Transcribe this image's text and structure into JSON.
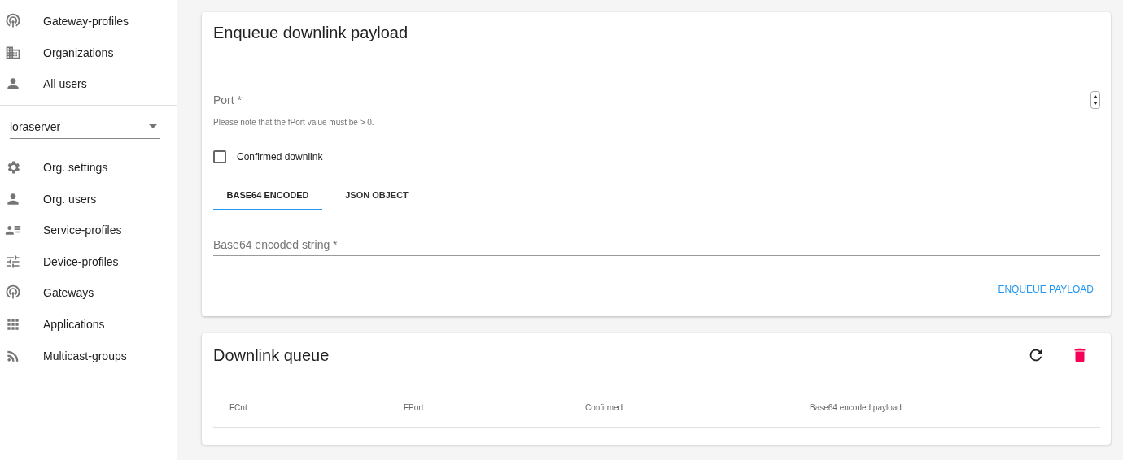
{
  "sidebar": {
    "top_items": [
      {
        "label": "Gateway-profiles"
      },
      {
        "label": "Organizations"
      },
      {
        "label": "All users"
      }
    ],
    "organization_select": {
      "value": "loraserver"
    },
    "org_items": [
      {
        "label": "Org. settings"
      },
      {
        "label": "Org. users"
      },
      {
        "label": "Service-profiles"
      },
      {
        "label": "Device-profiles"
      },
      {
        "label": "Gateways"
      },
      {
        "label": "Applications"
      },
      {
        "label": "Multicast-groups"
      }
    ]
  },
  "enqueue_card": {
    "title": "Enqueue downlink payload",
    "port_field": {
      "placeholder": "Port *",
      "helper": "Please note that the fPort value must be > 0."
    },
    "confirmed_checkbox": {
      "label": "Confirmed downlink",
      "checked": false
    },
    "tabs": [
      {
        "label": "BASE64 ENCODED",
        "selected": true
      },
      {
        "label": "JSON OBJECT",
        "selected": false
      }
    ],
    "payload_field": {
      "placeholder": "Base64 encoded string *"
    },
    "button": "ENQUEUE PAYLOAD"
  },
  "queue_card": {
    "title": "Downlink queue",
    "columns": [
      "FCnt",
      "FPort",
      "Confirmed",
      "Base64 encoded payload"
    ]
  }
}
